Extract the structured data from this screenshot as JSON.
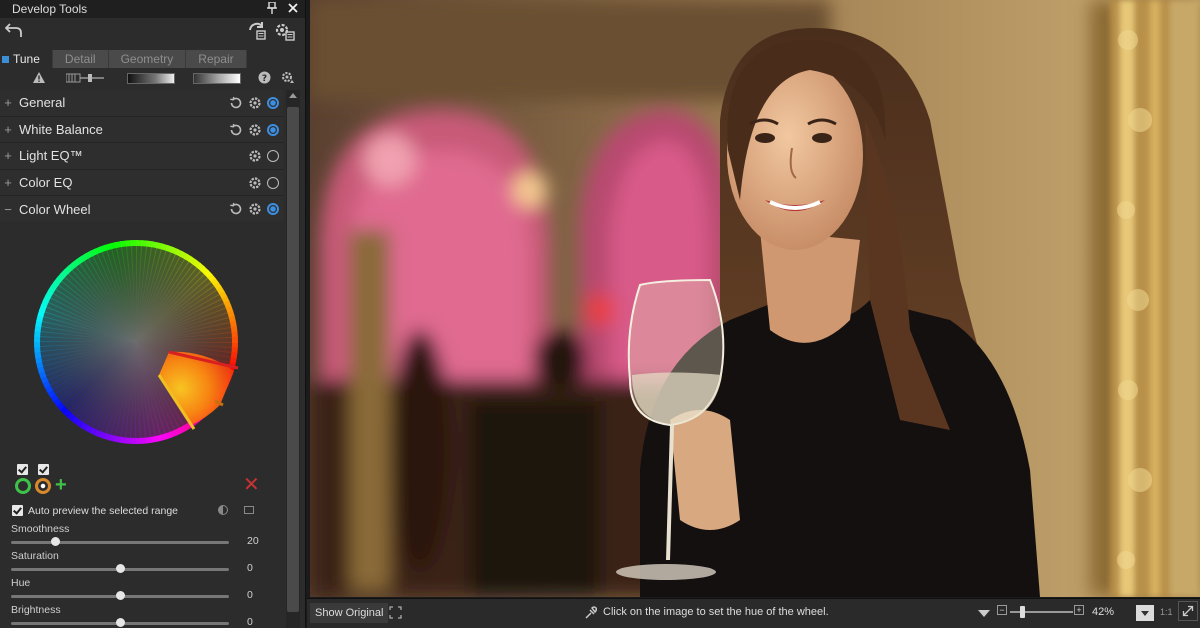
{
  "app": {
    "panel_title": "Develop Tools"
  },
  "tabs": [
    {
      "label": "Tune",
      "active": true
    },
    {
      "label": "Detail",
      "active": false
    },
    {
      "label": "Geometry",
      "active": false
    },
    {
      "label": "Repair",
      "active": false
    }
  ],
  "sections": [
    {
      "label": "General",
      "expanded": false,
      "enabled": true
    },
    {
      "label": "White Balance",
      "expanded": false,
      "enabled": true
    },
    {
      "label": "Light EQ™",
      "expanded": false,
      "enabled": false
    },
    {
      "label": "Color EQ",
      "expanded": false,
      "enabled": false
    },
    {
      "label": "Color Wheel",
      "expanded": true,
      "enabled": true
    }
  ],
  "color_wheel": {
    "auto_preview_label": "Auto preview the selected range",
    "auto_preview_checked": true,
    "range_colors": {
      "range1": "#3ec24a",
      "range2": "#d88a2c"
    },
    "add_symbol": "+",
    "delete_symbol": "✕",
    "sliders": [
      {
        "label": "Smoothness",
        "value": "20",
        "level": 0.2
      },
      {
        "label": "Saturation",
        "value": "0",
        "level": 0.5
      },
      {
        "label": "Hue",
        "value": "0",
        "level": 0.5
      },
      {
        "label": "Brightness",
        "value": "0",
        "level": 0.5
      }
    ]
  },
  "bottom_bar": {
    "show_original": "Show Original",
    "hint": "Click on the image to set the hue of the wheel.",
    "zoom": "42%",
    "one_to_one": "1:1"
  },
  "colors": {
    "accent": "#3b8ed6",
    "panel_bg": "#2c2c2c"
  }
}
